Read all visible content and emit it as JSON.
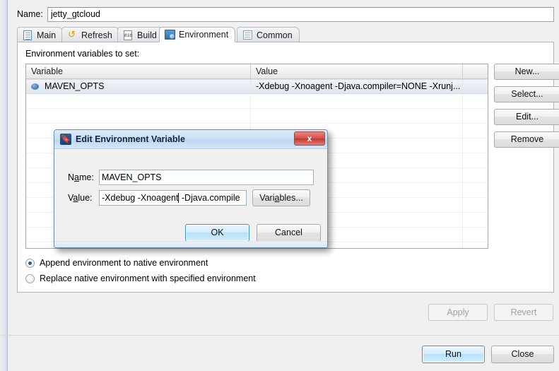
{
  "window": {
    "name_label": "Name:",
    "name_value": "jetty_gtcloud"
  },
  "tabs": [
    {
      "label": "Main",
      "icon": "document-icon",
      "active": false
    },
    {
      "label": "Refresh",
      "icon": "refresh-icon",
      "active": false
    },
    {
      "label": "Build",
      "icon": "build-icon",
      "active": false
    },
    {
      "label": "Environment",
      "icon": "environment-icon",
      "active": true
    },
    {
      "label": "Common",
      "icon": "common-icon",
      "active": false
    }
  ],
  "environment": {
    "section_label": "Environment variables to set:",
    "columns": [
      "Variable",
      "Value",
      ""
    ],
    "rows": [
      {
        "variable": "MAVEN_OPTS",
        "value": "-Xdebug -Xnoagent -Djava.compiler=NONE -Xrunj...",
        "selected": true
      }
    ],
    "buttons": [
      {
        "label": "New...",
        "enabled": true
      },
      {
        "label": "Select...",
        "enabled": true
      },
      {
        "label": "Edit...",
        "enabled": true
      },
      {
        "label": "Remove",
        "enabled": true
      }
    ],
    "radios": [
      {
        "label": "Append environment to native environment",
        "selected": true
      },
      {
        "label": "Replace native environment with specified environment",
        "selected": false
      }
    ]
  },
  "footer": {
    "apply_label": "Apply",
    "apply_enabled": false,
    "revert_label": "Revert",
    "revert_enabled": false,
    "run_label": "Run",
    "close_label": "Close"
  },
  "dialog": {
    "title": "Edit Environment Variable",
    "icon": "eclipse-debug-icon",
    "close_label": "x",
    "name_label_pre": "N",
    "name_label_mn": "a",
    "name_label_post": "me:",
    "name_value": "MAVEN_OPTS",
    "value_label_pre": "V",
    "value_label_mn": "a",
    "value_label_post": "lue:",
    "value_value": "-Xdebug -Xnoagent",
    "value_value_tail": " -Djava.compile",
    "variables_label_pre": "Vari",
    "variables_label_mn": "a",
    "variables_label_post": "bles...",
    "ok_label": "OK",
    "cancel_label": "Cancel"
  },
  "colors": {
    "accent_blue": "#3c93d0",
    "close_red": "#c03a33",
    "dialog_title": "#bcd7f0"
  }
}
